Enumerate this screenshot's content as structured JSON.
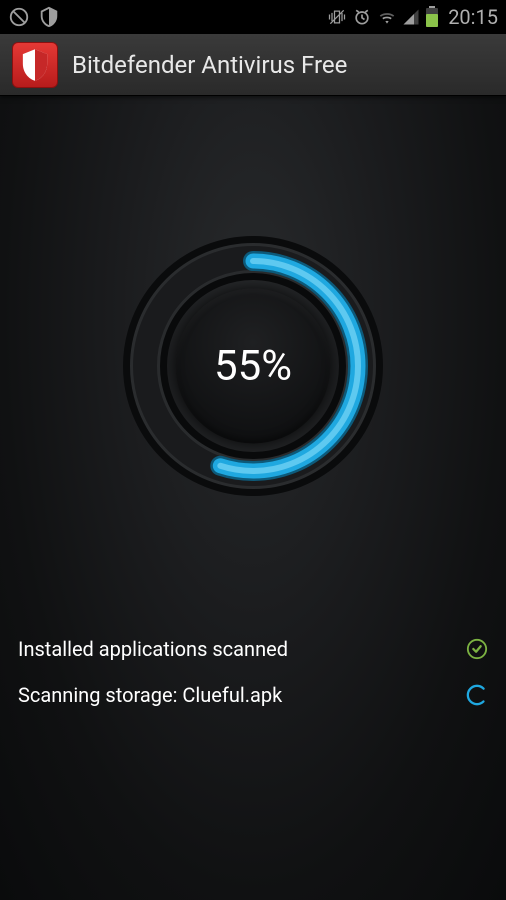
{
  "statusBar": {
    "time": "20:15"
  },
  "appBar": {
    "title": "Bitdefender Antivirus Free"
  },
  "progress": {
    "percent": "55%",
    "value": 55
  },
  "statusItems": [
    {
      "label": "Installed applications scanned",
      "state": "complete"
    },
    {
      "label": "Scanning storage: Clueful.apk",
      "state": "progress"
    }
  ],
  "colors": {
    "accent": "#1fa8e0",
    "success": "#7cb342"
  }
}
